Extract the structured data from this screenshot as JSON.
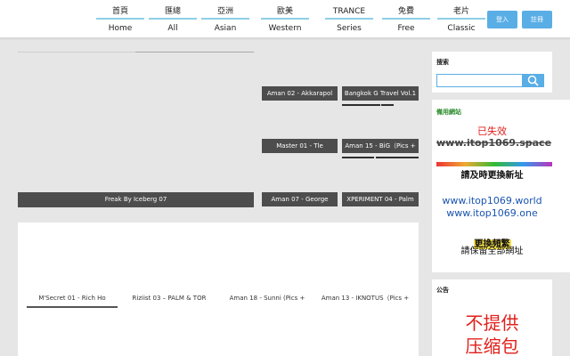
{
  "nav": {
    "items": [
      {
        "zh": "首頁",
        "en": "Home"
      },
      {
        "zh": "匯總",
        "en": "All"
      },
      {
        "zh": "亞洲",
        "en": "Asian"
      },
      {
        "zh": "歐美",
        "en": "Western"
      },
      {
        "zh": "TRANCE",
        "en": "Series"
      },
      {
        "zh": "免費",
        "en": "Free"
      },
      {
        "zh": "老片",
        "en": "Classic"
      }
    ],
    "login": "登入",
    "register": "註冊"
  },
  "featured": {
    "main_caption": "Freak By Iceberg 07",
    "small": [
      "Aman 02 - Akkarapol",
      "Bangkok G Travel Vol.1",
      "Master 01 - Tle",
      "Aman 15 - BiG（Pics +",
      "Aman 07 - George",
      "XPERIMENT 04 - Palm"
    ]
  },
  "tabs": [
    "M'Secret 01 - Rich Ho",
    "Riziist 03 – PALM & TOR",
    "Aman 18 - Sunni (Pics +",
    "Aman 13 - IKNOTUS（Pics +"
  ],
  "sidebar": {
    "search_title": "搜索",
    "backup_title": "備用網站",
    "invalid": "已失效",
    "old_domain": "www.itop1069.space",
    "update_notice": "請及時更換新址",
    "domain1": "www.itop1069.world",
    "domain2": "www.itop1069.one",
    "frequent": "更換頻繁",
    "keep_all": "請保留全部網址",
    "notice_title": "公告",
    "notice_line1": "不提供",
    "notice_line2": "压缩包"
  }
}
